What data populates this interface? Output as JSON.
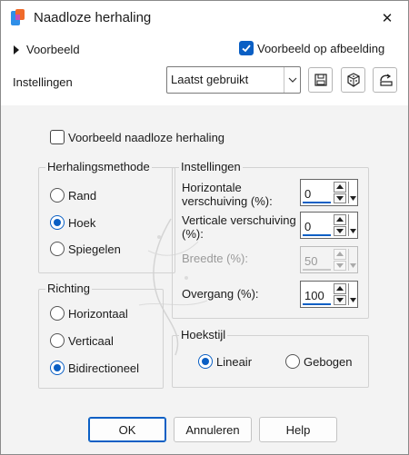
{
  "window": {
    "title": "Naadloze herhaling",
    "close_glyph": "✕"
  },
  "top": {
    "preview_toggle_label": "Voorbeeld",
    "preview_on_image_label": "Voorbeeld op afbeelding",
    "preview_on_image_checked": true,
    "settings_label": "Instellingen",
    "preset_value": "Laatst gebruikt"
  },
  "options": {
    "seamless_preview_label": "Voorbeeld naadloze herhaling",
    "seamless_preview_checked": false
  },
  "method_group": {
    "title": "Herhalingsmethode",
    "options": [
      {
        "label": "Rand",
        "checked": false
      },
      {
        "label": "Hoek",
        "checked": true
      },
      {
        "label": "Spiegelen",
        "checked": false
      }
    ]
  },
  "direction_group": {
    "title": "Richting",
    "options": [
      {
        "label": "Horizontaal",
        "checked": false
      },
      {
        "label": "Verticaal",
        "checked": false
      },
      {
        "label": "Bidirectioneel",
        "checked": true
      }
    ]
  },
  "settings_group": {
    "title": "Instellingen",
    "fields": [
      {
        "label_line1": "Horizontale",
        "label_line2": "verschuiving (%):",
        "value": "0",
        "enabled": true
      },
      {
        "label_line1": "Verticale verschuiving",
        "label_line2": "(%):",
        "value": "0",
        "enabled": true
      },
      {
        "label_line1": "Breedte (%):",
        "label_line2": "",
        "value": "50",
        "enabled": false
      },
      {
        "label_line1": "Overgang (%):",
        "label_line2": "",
        "value": "100",
        "enabled": true
      }
    ]
  },
  "corner_group": {
    "title": "Hoekstijl",
    "options": [
      {
        "label": "Lineair",
        "checked": true
      },
      {
        "label": "Gebogen",
        "checked": false
      }
    ]
  },
  "buttons": {
    "ok": "OK",
    "cancel": "Annuleren",
    "help": "Help"
  },
  "colors": {
    "accent": "#0a5fc4",
    "dialog_bg": "#f3f3f3"
  },
  "icons": [
    "app-icon",
    "close-icon",
    "save-preset-icon",
    "reset-icon",
    "undo-preset-icon",
    "watermark-logo"
  ]
}
